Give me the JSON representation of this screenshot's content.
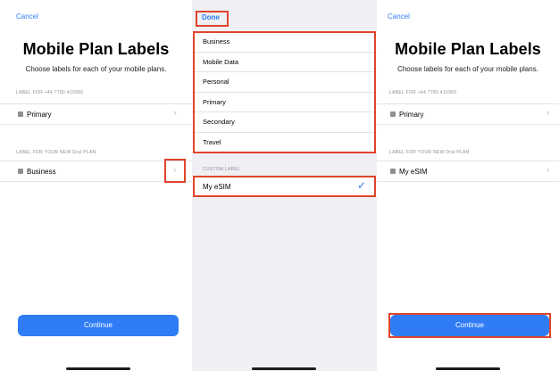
{
  "screen1": {
    "cancel": "Cancel",
    "title": "Mobile Plan Labels",
    "subtitle": "Choose labels for each of your mobile plans.",
    "section1_header": "LABEL FOR +44 7780 410360",
    "plan1_label": "Primary",
    "section2_header": "LABEL FOR YOUR NEW Dral PLAN",
    "plan2_label": "Business",
    "continue": "Continue"
  },
  "screen2": {
    "done": "Done",
    "options": [
      "Business",
      "Mobile Data",
      "Personal",
      "Primary",
      "Secondary",
      "Travel"
    ],
    "custom_header": "CUSTOM LABEL",
    "custom_value": "My eSIM"
  },
  "screen3": {
    "cancel": "Cancel",
    "title": "Mobile Plan Labels",
    "subtitle": "Choose labels for each of your mobile plans.",
    "section1_header": "LABEL FOR +44 7780 410360",
    "plan1_label": "Primary",
    "section2_header": "LABEL FOR YOUR NEW Dral PLAN",
    "plan2_label": "My eSIM",
    "continue": "Continue"
  },
  "colors": {
    "accent": "#2f7cf6",
    "highlight": "#e0442b"
  },
  "icons": [
    "sim-card-icon",
    "chevron-right-icon",
    "checkmark-icon"
  ]
}
